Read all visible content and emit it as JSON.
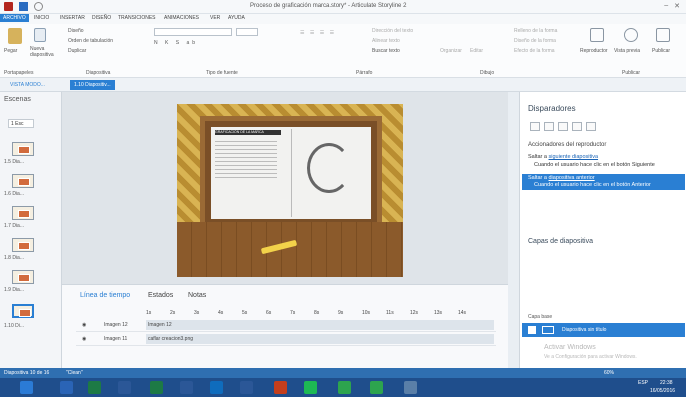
{
  "window": {
    "title": "Proceso de graficación marca.story* - Articulate Storyline 2"
  },
  "tabs": [
    "ARCHIVO",
    "INICIO",
    "INSERTAR",
    "DISEÑO",
    "TRANSICIONES",
    "ANIMACIONES",
    "VER",
    "AYUDA"
  ],
  "active_tab": "INICIO",
  "ribbon": {
    "paste_label": "Pegar",
    "new_slide_label": "Nueva diapositiva",
    "layout_label": "Diseño",
    "tab_order_label": "Orden de tabulación",
    "duplicate_label": "Duplicar",
    "groups": [
      "Portapapeles",
      "Diapositiva",
      "Tipo de fuente",
      "Párrafo",
      "Dibujo",
      "Publicar"
    ],
    "text_direction_label": "Dirección del texto",
    "align_text_label": "Alinear texto",
    "find_text_label": "Buscar texto",
    "arrange_label": "Organizar",
    "edit_label": "Editar",
    "fill_label": "Relleno de la forma",
    "outline_label": "Diseño de la forma",
    "effects_label": "Efecto de la forma",
    "player_label": "Reproductor",
    "preview_label": "Vista previa",
    "publish_label": "Publicar"
  },
  "subtabs": {
    "story_view": "VISTA MODO...",
    "slide_tab": "1.10 Diapositiv..."
  },
  "scenes": {
    "title": "Escenas",
    "selected": "1 Esc",
    "items": [
      "1.5 Dia...",
      "1.6 Dia...",
      "1.7 Dia...",
      "1.8 Dia...",
      "1.9 Dia...",
      "1.10 Di..."
    ]
  },
  "slide": {
    "board_title": "GRAFICACIÓN DE LA MARCA"
  },
  "triggers": {
    "panel_title": "Disparadores",
    "player_section": "Accionadores del reproductor",
    "items": [
      {
        "prefix": "Saltar a",
        "link": "siguiente diapositiva",
        "desc": "Cuando el usuario hace clic en el botón Siguiente"
      },
      {
        "prefix": "Saltar a",
        "link": "diapositiva anterior",
        "desc": "Cuando el usuario hace clic en el botón Anterior"
      }
    ]
  },
  "layers": {
    "panel_title": "Capas de diapositiva",
    "base_label": "Capa base",
    "base_layer": "Diapositiva sin título"
  },
  "timeline": {
    "tabs": [
      "Línea de tiempo",
      "Estados",
      "Notas"
    ],
    "ruler": [
      "1s",
      "2s",
      "3s",
      "4s",
      "5s",
      "6s",
      "7s",
      "8s",
      "9s",
      "10s",
      "11s",
      "12s",
      "13s",
      "14s"
    ],
    "rows": [
      {
        "name": "Imagen 12",
        "bar": "Imagen 12"
      },
      {
        "name": "Imagen 11",
        "bar": "caflar creacion3.png"
      }
    ]
  },
  "status": {
    "slide_info": "Diapositiva 10 de 16",
    "theme": "\"Clean\"",
    "zoom": "60%"
  },
  "watermark": {
    "title": "Activar Windows",
    "subtitle": "Ve a Configuración para activar Windows."
  },
  "taskbar": {
    "lang": "ESP",
    "time": "22:38",
    "date": "16/05/2016"
  },
  "colors": {
    "accent": "#2a7fd3",
    "taskbar": "#1f4e8c",
    "status": "#2f6fb1"
  }
}
